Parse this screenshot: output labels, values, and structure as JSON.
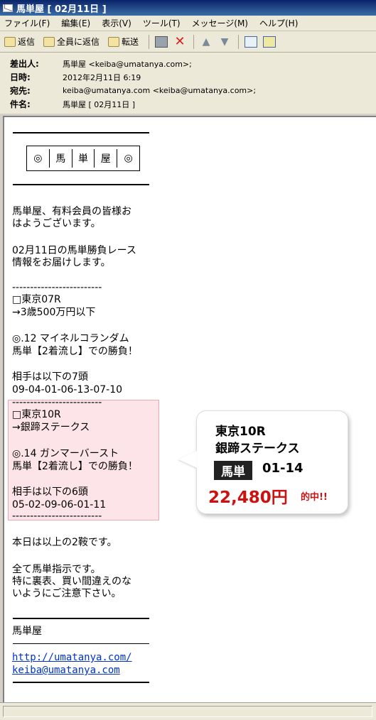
{
  "window": {
    "title": "馬単屋 [ 02月11日 ]"
  },
  "menu": [
    "ファイル(F)",
    "編集(E)",
    "表示(V)",
    "ツール(T)",
    "メッセージ(M)",
    "ヘルプ(H)"
  ],
  "toolbar": {
    "reply": "返信",
    "reply_all": "全員に返信",
    "forward": "転送"
  },
  "headers": {
    "from_label": "差出人:",
    "from": "馬単屋 <keiba@umatanya.com>;",
    "date_label": "日時:",
    "date": "2012年2月11日 6:19",
    "to_label": "宛先:",
    "to": "keiba@umatanya.com <keiba@umatanya.com>;",
    "subject_label": "件名:",
    "subject": "馬単屋 [ 02月11日 ]"
  },
  "logo": [
    "◎",
    "馬",
    "単",
    "屋",
    "◎"
  ],
  "mail": {
    "greeting1": "馬単屋、有料会員の皆様お",
    "greeting2": "はようございます。",
    "intro1": "02月11日の馬単勝負レース",
    "intro2": "情報をお届けします。",
    "dash": "-------------------------",
    "race1_name": "□東京07R",
    "race1_cond": "→3歳500万円以下",
    "race1_pick": "◎.12 マイネルコランダム",
    "race1_bet": "馬単【2着流し】での勝負！",
    "race1_partners_label": "相手は以下の7頭",
    "race1_partners": "09-04-01-06-13-07-10",
    "race2_name": "□東京10R",
    "race2_cond": "→銀蹄ステークス",
    "race2_pick": "◎.14 ガンマーバースト",
    "race2_bet": "馬単【2着流し】での勝負！",
    "race2_partners_label": "相手は以下の6頭",
    "race2_partners": "05-02-09-06-01-11",
    "closing1": "本日は以上の2鞍です。",
    "closing2": "全て馬単指示です。",
    "closing3": "特に裏表、買い間違えのな",
    "closing4": "いようにご注意下さい。",
    "signature": "馬単屋",
    "url": "http://umatanya.com/",
    "email": "keiba@umatanya.com"
  },
  "callout": {
    "line1": "東京10R",
    "line2": "銀蹄ステークス",
    "badge": "馬単",
    "numbers": "01-14",
    "amount": "22,480円",
    "hit": "的中!!"
  }
}
